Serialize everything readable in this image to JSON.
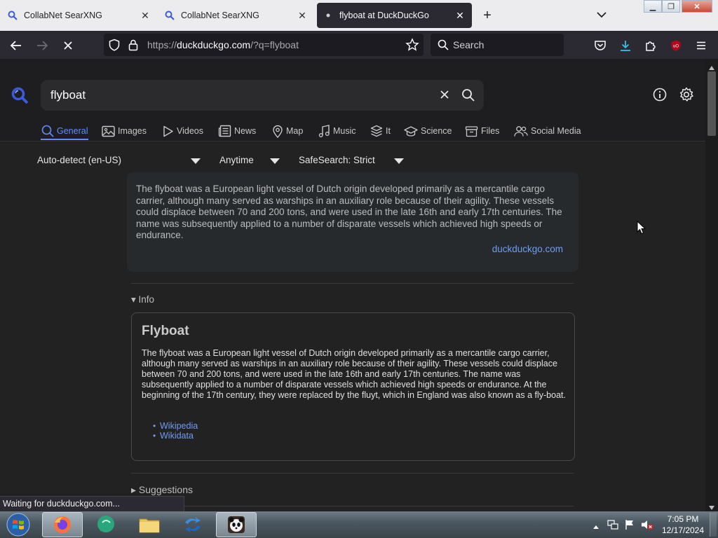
{
  "browser": {
    "tabs": [
      {
        "title": "CollabNet SearXNG",
        "active": false
      },
      {
        "title": "CollabNet SearXNG",
        "active": false
      },
      {
        "title": "flyboat at DuckDuckGo",
        "active": true
      }
    ],
    "url_prefix": "https://",
    "url_domain": "duckduckgo.com",
    "url_path": "/?q=flyboat",
    "search_placeholder": "Search",
    "status": "Waiting for duckduckgo.com..."
  },
  "page": {
    "query": "flyboat",
    "categories": [
      {
        "label": "General",
        "icon": "search-icon",
        "active": true
      },
      {
        "label": "Images",
        "icon": "image-icon"
      },
      {
        "label": "Videos",
        "icon": "play-icon"
      },
      {
        "label": "News",
        "icon": "newspaper-icon"
      },
      {
        "label": "Map",
        "icon": "map-pin-icon"
      },
      {
        "label": "Music",
        "icon": "music-icon"
      },
      {
        "label": "It",
        "icon": "layers-icon"
      },
      {
        "label": "Science",
        "icon": "graduation-cap-icon"
      },
      {
        "label": "Files",
        "icon": "archive-icon"
      },
      {
        "label": "Social Media",
        "icon": "users-icon"
      }
    ],
    "filters": {
      "language": "Auto-detect (en-US)",
      "time": "Anytime",
      "safesearch": "SafeSearch: Strict"
    },
    "answer": {
      "text": "The flyboat was a European light vessel of Dutch origin developed primarily as a mercantile cargo carrier, although many served as warships in an auxiliary role because of their agility. These vessels could displace between 70 and 200 tons, and were used in the late 16th and early 17th centuries. The name was subsequently applied to a number of disparate vessels which achieved high speeds or endurance.",
      "source": "duckduckgo.com"
    },
    "info_label": "Info",
    "infobox": {
      "title": "Flyboat",
      "text": "The flyboat was a European light vessel of Dutch origin developed primarily as a mercantile cargo carrier, although many served as warships in an auxiliary role because of their agility. These vessels could displace between 70 and 200 tons, and were used in the late 16th and early 17th centuries. The name was subsequently applied to a number of disparate vessels which achieved high speeds or endurance. At the beginning of the 17th century, they were replaced by the fluyt, which in England was also known as a fly-boat.",
      "links": [
        "Wikipedia",
        "Wikidata"
      ]
    },
    "suggestions_label": "Suggestions"
  },
  "taskbar": {
    "time": "7:05 PM",
    "date": "12/17/2024"
  },
  "colors": {
    "accent": "#5f8dff",
    "link": "#6f9cf5",
    "page_bg": "#222222"
  }
}
